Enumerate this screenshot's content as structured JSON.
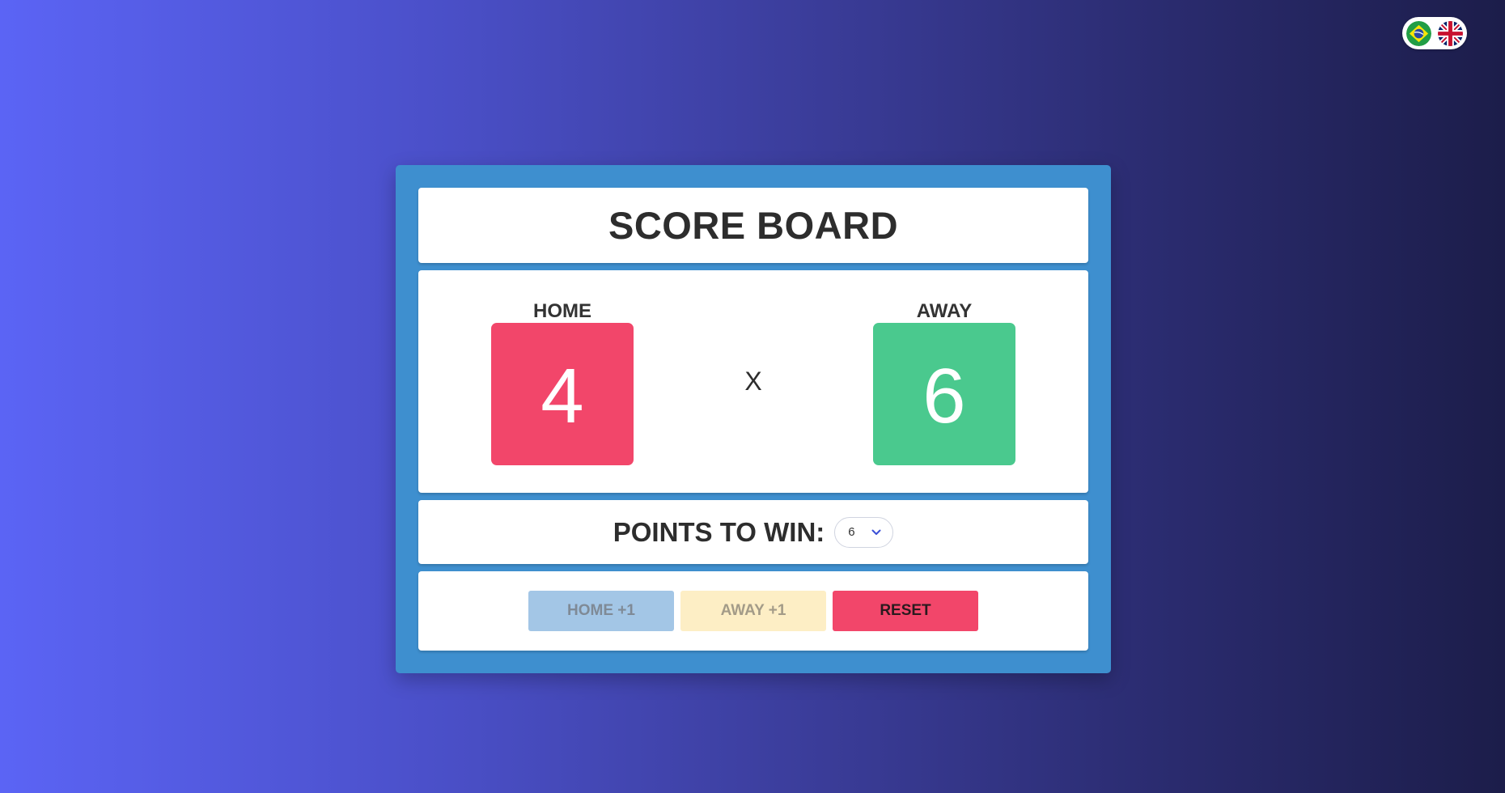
{
  "language_switch": {
    "flags": [
      {
        "icon": "brazil-flag-icon",
        "code": "pt-BR"
      },
      {
        "icon": "uk-flag-icon",
        "code": "en-GB"
      }
    ]
  },
  "header": {
    "title": "SCORE BOARD"
  },
  "scoreboard": {
    "home": {
      "label": "HOME",
      "score": "4",
      "color": "#f2466a"
    },
    "separator": "X",
    "away": {
      "label": "AWAY",
      "score": "6",
      "color": "#4ac98e"
    }
  },
  "points_to_win": {
    "label": "POINTS TO WIN:",
    "selected": "6",
    "icon": "chevron-down-icon"
  },
  "actions": {
    "home_label": "HOME +1",
    "away_label": "AWAY +1",
    "reset_label": "RESET"
  },
  "colors": {
    "board": "#3e8fcf",
    "home_button": "#a3c6e6",
    "away_button": "#fdeec5",
    "reset_button": "#f2466a"
  }
}
